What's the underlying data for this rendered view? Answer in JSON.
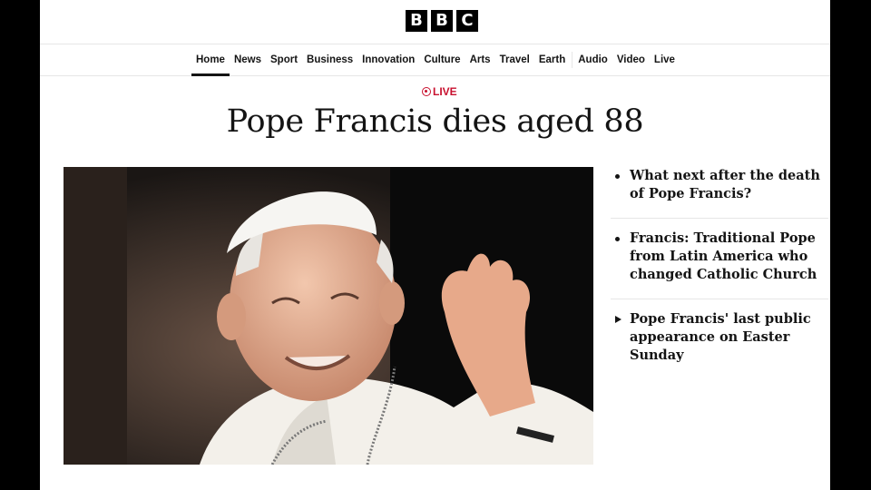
{
  "brand": {
    "letters": [
      "B",
      "B",
      "C"
    ]
  },
  "nav": {
    "items": [
      "Home",
      "News",
      "Sport",
      "Business",
      "Innovation",
      "Culture",
      "Arts",
      "Travel",
      "Earth",
      "Audio",
      "Video",
      "Live"
    ],
    "active": "Home"
  },
  "live_label": "LIVE",
  "headline": "Pope Francis dies aged 88",
  "related": [
    {
      "text": "What next after the death of Pope Francis?",
      "icon": "bullet-icon"
    },
    {
      "text": "Francis: Traditional Pope from Latin America who changed Catholic Church",
      "icon": "bullet-icon"
    },
    {
      "text": "Pope Francis' last public appearance on Easter Sunday",
      "icon": "play-icon"
    }
  ],
  "colors": {
    "live_red": "#c8102e",
    "text": "#141414"
  }
}
